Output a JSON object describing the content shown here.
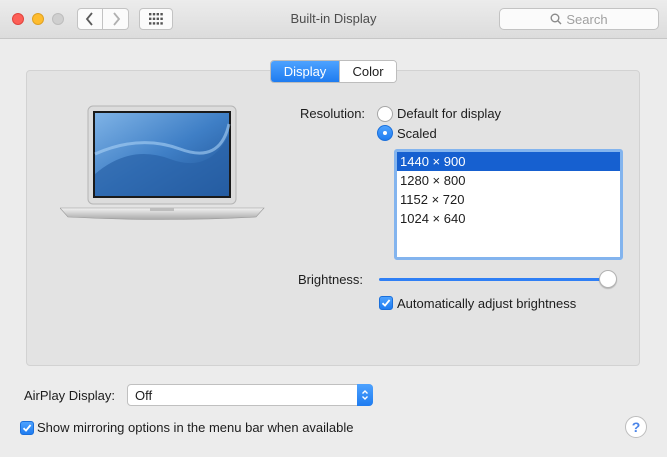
{
  "window": {
    "title": "Built-in Display",
    "search_placeholder": "Search"
  },
  "tabs": [
    {
      "label": "Display",
      "active": true
    },
    {
      "label": "Color",
      "active": false
    }
  ],
  "resolution": {
    "label": "Resolution:",
    "options": [
      "Default for display",
      "Scaled"
    ],
    "selected_option": "Scaled",
    "list": [
      "1440 × 900",
      "1280 × 800",
      "1152 × 720",
      "1024 × 640"
    ],
    "selected_item": "1440 × 900"
  },
  "brightness": {
    "label": "Brightness:",
    "level_percent": 96,
    "auto_label": "Automatically adjust brightness",
    "auto_checked": true
  },
  "airplay": {
    "label": "AirPlay Display:",
    "value": "Off"
  },
  "mirroring": {
    "label": "Show mirroring options in the menu bar when available",
    "checked": true
  },
  "help_label": "?",
  "colors": {
    "accent": "#1f7cf0",
    "selection": "#1660d0",
    "close": "#fd5f57",
    "minimize": "#febc2e"
  },
  "icons": [
    "close-icon",
    "minimize-icon",
    "zoom-icon",
    "chevron-left-icon",
    "chevron-right-icon",
    "grid-icon",
    "search-icon",
    "checkmark-icon",
    "up-down-chevron-icon",
    "laptop-icon"
  ]
}
